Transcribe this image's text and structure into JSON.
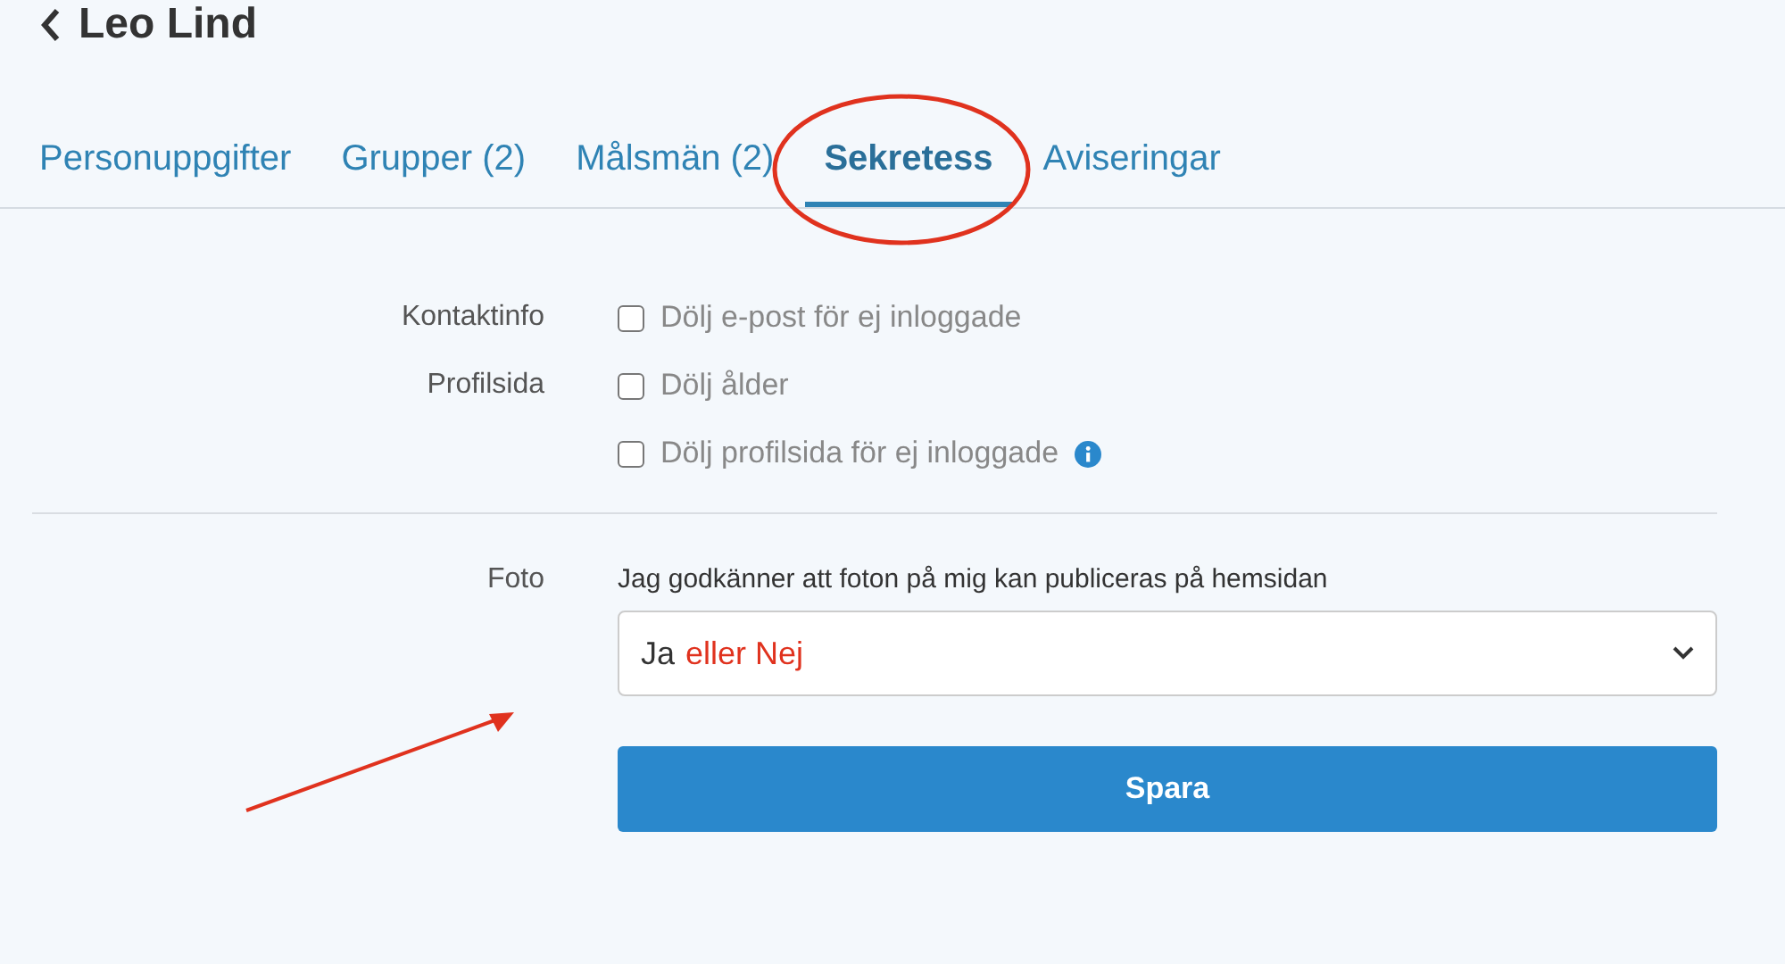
{
  "header": {
    "title": "Leo Lind"
  },
  "tabs": [
    {
      "label": "Personuppgifter",
      "selected": false,
      "circled": false
    },
    {
      "label": "Grupper (2)",
      "selected": false,
      "circled": false
    },
    {
      "label": "Målsmän (2)",
      "selected": false,
      "circled": false
    },
    {
      "label": "Sekretess",
      "selected": true,
      "circled": true
    },
    {
      "label": "Aviseringar",
      "selected": false,
      "circled": false
    }
  ],
  "sections": [
    {
      "label": "Kontaktinfo",
      "options": [
        {
          "label": "Dölj e-post för ej inloggade",
          "checked": false,
          "info": false
        }
      ]
    },
    {
      "label": "Profilsida",
      "options": [
        {
          "label": "Dölj ålder",
          "checked": false,
          "info": false
        },
        {
          "label": "Dölj profilsida för ej inloggade",
          "checked": false,
          "info": true
        }
      ]
    }
  ],
  "photo": {
    "label": "Foto",
    "question": "Jag godkänner att foton på mig kan publiceras på hemsidan",
    "value": "Ja",
    "annotation": "eller Nej",
    "arrow": true
  },
  "save_button": "Spara"
}
